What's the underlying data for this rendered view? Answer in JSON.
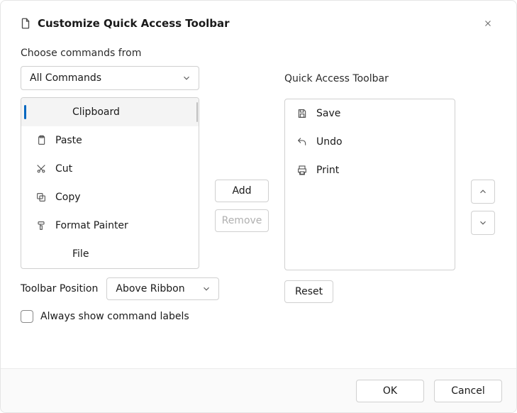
{
  "header": {
    "title": "Customize Quick Access Toolbar"
  },
  "left": {
    "section_label": "Choose commands from",
    "select_value": "All Commands",
    "items": [
      {
        "label": "Clipboard",
        "icon": "none",
        "selected": true
      },
      {
        "label": "Paste",
        "icon": "paste",
        "selected": false
      },
      {
        "label": "Cut",
        "icon": "cut",
        "selected": false
      },
      {
        "label": "Copy",
        "icon": "copy",
        "selected": false
      },
      {
        "label": "Format Painter",
        "icon": "paint",
        "selected": false
      },
      {
        "label": "File",
        "icon": "none",
        "selected": false
      }
    ]
  },
  "mid": {
    "add_label": "Add",
    "remove_label": "Remove"
  },
  "right": {
    "section_label": "Quick Access Toolbar",
    "items": [
      {
        "label": "Save",
        "icon": "save"
      },
      {
        "label": "Undo",
        "icon": "undo"
      },
      {
        "label": "Print",
        "icon": "print"
      }
    ],
    "reset_label": "Reset"
  },
  "toolbar_position": {
    "label": "Toolbar Position",
    "value": "Above Ribbon"
  },
  "checkbox": {
    "label": "Always show command labels",
    "checked": false
  },
  "footer": {
    "ok_label": "OK",
    "cancel_label": "Cancel"
  }
}
